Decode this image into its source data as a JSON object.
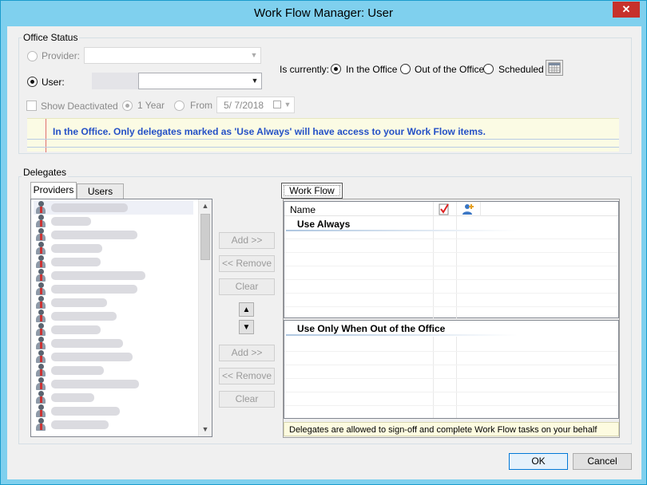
{
  "window": {
    "title": "Work Flow Manager: User",
    "close_glyph": "✕"
  },
  "office_status": {
    "group_label": "Office Status",
    "provider_label": "Provider:",
    "user_label": "User:",
    "is_currently_label": "Is currently:",
    "status_options": [
      "In the Office",
      "Out of the Office",
      "Scheduled"
    ],
    "selected_status": "In the Office",
    "show_deactivated_label": "Show Deactivated",
    "one_year_label": "1 Year",
    "from_label": "From",
    "from_date": "5/ 7/2018",
    "notice": "In the Office.  Only delegates marked as 'Use Always' will have access to your Work Flow items."
  },
  "delegates": {
    "group_label": "Delegates",
    "tabs": [
      "Providers",
      "Users"
    ],
    "active_tab": "Providers",
    "row_count": 17,
    "buttons_top": {
      "add": "Add >>",
      "remove": "<< Remove",
      "clear": "Clear"
    },
    "buttons_bottom": {
      "add": "Add >>",
      "remove": "<< Remove",
      "clear": "Clear"
    },
    "move_up_glyph": "▲",
    "move_down_glyph": "▼",
    "workflow_tab": "Work Flow",
    "name_column": "Name",
    "section_always": "Use Always",
    "section_out": "Use Only When Out of the Office",
    "footnote": "Delegates are allowed to sign-off and complete Work Flow tasks on your behalf"
  },
  "dialog": {
    "ok": "OK",
    "cancel": "Cancel"
  },
  "colors": {
    "notice_text": "#2450c6",
    "title_bar": "#7fd0ee",
    "close_button": "#c7312b"
  },
  "icons": [
    "calendar-icon",
    "person-icon",
    "signoff-check-icon",
    "add-user-icon",
    "close-icon"
  ]
}
